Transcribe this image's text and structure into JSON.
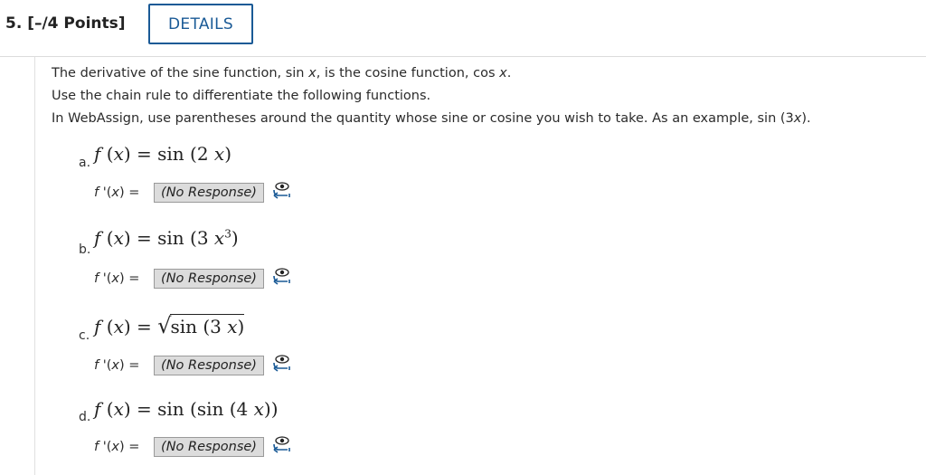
{
  "header": {
    "question_label": "5.  [–/4 Points]",
    "details_label": "DETAILS"
  },
  "intro": {
    "line1_a": "The derivative of the sine function, sin ",
    "line1_x1": "x",
    "line1_b": ", is the cosine function, cos ",
    "line1_x2": "x",
    "line1_c": ".",
    "line2": "Use the chain rule to differentiate the following functions.",
    "line3_a": "In WebAssign, use parentheses around the quantity whose sine or cosine you wish to take. As an example, sin (3",
    "line3_x": "x",
    "line3_b": ")."
  },
  "parts": [
    {
      "letter": "a.",
      "lhs": "f (x) = ",
      "rhs": "sin (2 x)",
      "fprime": "f '(x) = ",
      "response": "(No Response)"
    },
    {
      "letter": "b.",
      "lhs": "f (x) = ",
      "rhs": "sin (3 x",
      "exp": "3",
      "rhs_close": ")",
      "fprime": "f '(x) = ",
      "response": "(No Response)"
    },
    {
      "letter": "c.",
      "lhs": "f (x) = ",
      "rhs": "sin (3 x)",
      "fprime": "f '(x) = ",
      "response": "(No Response)"
    },
    {
      "letter": "d.",
      "lhs": "f (x) = ",
      "rhs": "sin (sin (4 x))",
      "fprime": "f '(x) = ",
      "response": "(No Response)"
    }
  ],
  "icons": {
    "view_answer": "eye-icon",
    "accent": "#1a5a96"
  }
}
